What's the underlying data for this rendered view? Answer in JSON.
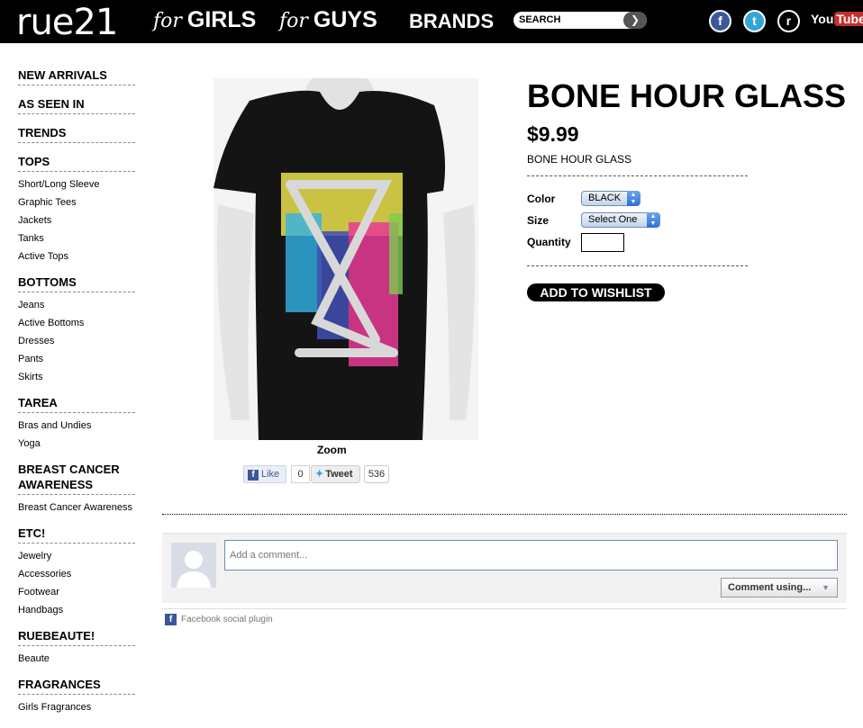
{
  "header": {
    "logo": "rue21",
    "nav": [
      {
        "prefix": "for",
        "label": "GIRLS"
      },
      {
        "prefix": "for",
        "label": "GUYS"
      },
      {
        "prefix": "",
        "label": "BRANDS"
      }
    ],
    "search_label": "SEARCH",
    "search_go": "❯",
    "social": {
      "facebook": "f",
      "twitter": "t",
      "rue": "r",
      "youtube_you": "You",
      "youtube_tube": "Tube"
    }
  },
  "sidebar": {
    "top_links": [
      "NEW ARRIVALS",
      "AS SEEN IN",
      "TRENDS"
    ],
    "groups": [
      {
        "title": "TOPS",
        "items": [
          "Short/Long Sleeve",
          "Graphic Tees",
          "Jackets",
          "Tanks",
          "Active Tops"
        ]
      },
      {
        "title": "BOTTOMS",
        "items": [
          "Jeans",
          "Active Bottoms",
          "Dresses",
          "Pants",
          "Skirts"
        ]
      },
      {
        "title": "TAREA",
        "items": [
          "Bras and Undies",
          "Yoga"
        ]
      },
      {
        "title": "BREAST CANCER AWARENESS",
        "items": [
          "Breast Cancer Awareness"
        ]
      },
      {
        "title": "ETC!",
        "items": [
          "Jewelry",
          "Accessories",
          "Footwear",
          "Handbags"
        ]
      },
      {
        "title": "RUEBEAUTE!",
        "items": [
          "Beaute"
        ]
      },
      {
        "title": "FRAGRANCES",
        "items": [
          "Girls Fragrances"
        ]
      }
    ]
  },
  "product": {
    "title": "BONE HOUR GLASS",
    "price": "$9.99",
    "subtitle": "BONE HOUR GLASS",
    "color_label": "Color",
    "color_value": "BLACK",
    "size_label": "Size",
    "size_value": "Select One",
    "quantity_label": "Quantity",
    "wishlist_label": "ADD TO WISHLIST",
    "zoom_label": "Zoom"
  },
  "share": {
    "like_label": "Like",
    "like_count": "0",
    "tweet_label": "Tweet",
    "tweet_count": "536"
  },
  "comments": {
    "placeholder": "Add a comment...",
    "comment_using": "Comment using...",
    "plugin_label": "Facebook social plugin"
  },
  "colors": {
    "header_bg": "#000000",
    "facebook": "#3b5998",
    "twitter": "#33a6d7",
    "youtube": "#c4302b"
  }
}
